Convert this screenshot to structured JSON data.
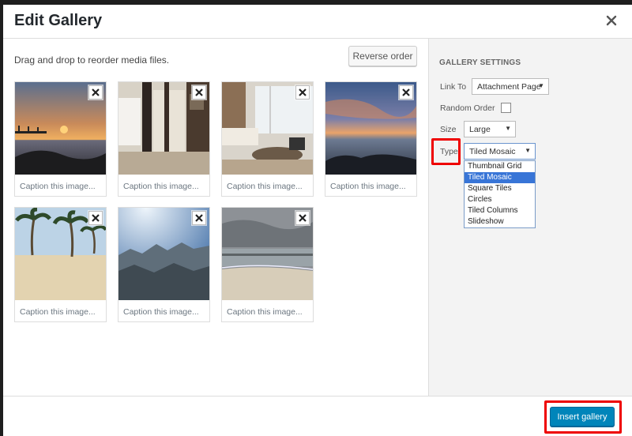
{
  "modal": {
    "title": "Edit Gallery",
    "close_icon": "close-icon"
  },
  "content": {
    "hint": "Drag and drop to reorder media files.",
    "reverse_label": "Reverse order",
    "images": [
      {
        "caption_placeholder": "Caption this image...",
        "scene": "sunset pier over sea"
      },
      {
        "caption_placeholder": "Caption this image...",
        "scene": "hotel room interior with doors"
      },
      {
        "caption_placeholder": "Caption this image...",
        "scene": "living room with sofa and window"
      },
      {
        "caption_placeholder": "Caption this image...",
        "scene": "sunset over rocky shore"
      },
      {
        "caption_placeholder": "Caption this image...",
        "scene": "palm trees on sandy beach"
      },
      {
        "caption_placeholder": "Caption this image...",
        "scene": "misty mountain ridge"
      },
      {
        "caption_placeholder": "Caption this image...",
        "scene": "cloudy beach shoreline"
      }
    ]
  },
  "sidebar": {
    "title": "Gallery Settings",
    "link_to": {
      "label": "Link To",
      "value": "Attachment Page"
    },
    "random_order": {
      "label": "Random Order",
      "checked": false
    },
    "size": {
      "label": "Size",
      "value": "Large"
    },
    "type": {
      "label": "Type",
      "value": "Tiled Mosaic",
      "options": [
        "Thumbnail Grid",
        "Tiled Mosaic",
        "Square Tiles",
        "Circles",
        "Tiled Columns",
        "Slideshow"
      ],
      "selected_index": 1
    }
  },
  "footer": {
    "insert_label": "Insert gallery"
  },
  "colors": {
    "primary_button": "#0085ba",
    "highlight": "#ee0000",
    "option_selected": "#3875d7"
  }
}
